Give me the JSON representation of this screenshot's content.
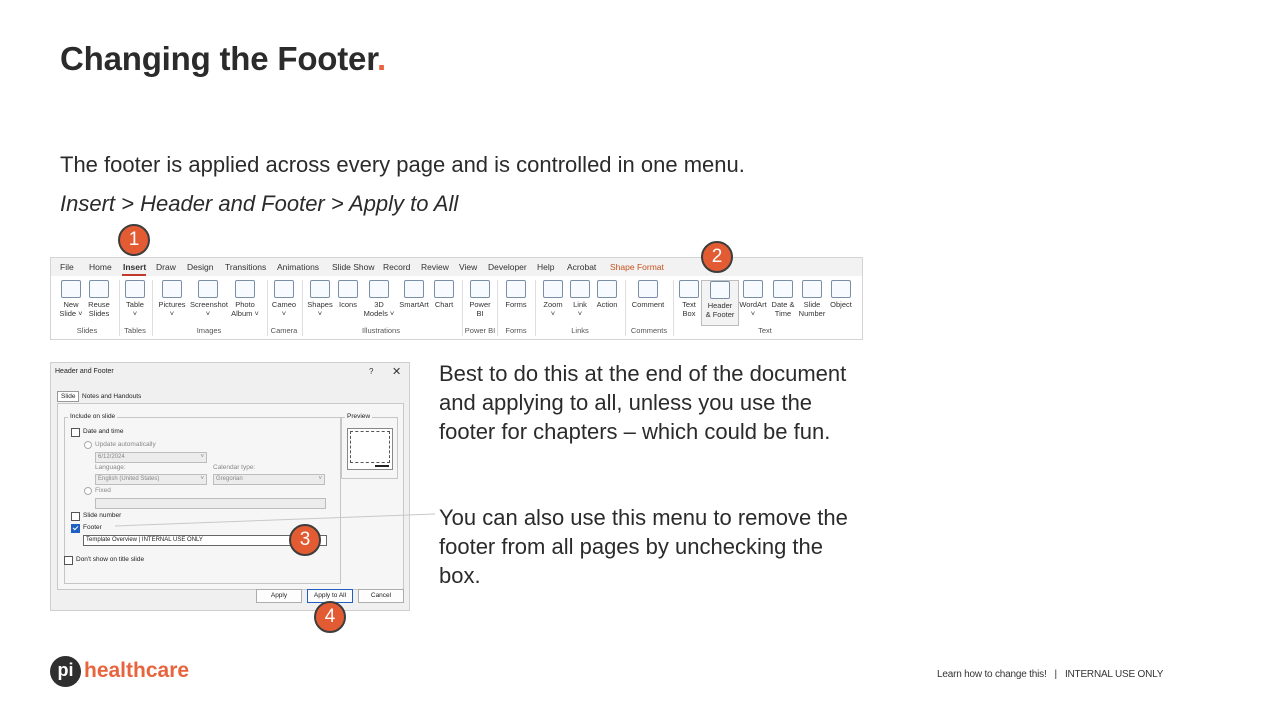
{
  "slide": {
    "title": "Changing the Footer",
    "title_punct": ".",
    "intro": "The footer is applied across every page and is controlled in one menu.",
    "path": "Insert > Header and Footer > Apply to All",
    "para1": "Best to do this at the end of the document and applying to all, unless you use the footer for chapters – which could be fun.",
    "para2": "You can also use this menu to remove the footer from all pages by unchecking the box."
  },
  "badges": [
    "1",
    "2",
    "3",
    "4"
  ],
  "ribbon": {
    "tabs": [
      "File",
      "Home",
      "Insert",
      "Draw",
      "Design",
      "Transitions",
      "Animations",
      "Slide Show",
      "Record",
      "Review",
      "View",
      "Developer",
      "Help",
      "Acrobat",
      "Shape Format"
    ],
    "buttons": [
      {
        "label": "New\nSlide ˅",
        "icon": "new-slide-icon"
      },
      {
        "label": "Reuse\nSlides",
        "icon": "reuse-slides-icon"
      },
      {
        "label": "Table\n˅",
        "icon": "table-icon"
      },
      {
        "label": "Pictures\n˅",
        "icon": "pictures-icon"
      },
      {
        "label": "Screenshot\n˅",
        "icon": "screenshot-icon"
      },
      {
        "label": "Photo\nAlbum ˅",
        "icon": "photo-album-icon"
      },
      {
        "label": "Cameo\n˅",
        "icon": "cameo-icon"
      },
      {
        "label": "Shapes\n˅",
        "icon": "shapes-icon"
      },
      {
        "label": "Icons",
        "icon": "icons-icon"
      },
      {
        "label": "3D\nModels ˅",
        "icon": "3d-models-icon"
      },
      {
        "label": "SmartArt",
        "icon": "smartart-icon"
      },
      {
        "label": "Chart",
        "icon": "chart-icon"
      },
      {
        "label": "Power\nBI",
        "icon": "power-bi-icon"
      },
      {
        "label": "Forms",
        "icon": "forms-icon"
      },
      {
        "label": "Zoom\n˅",
        "icon": "zoom-icon"
      },
      {
        "label": "Link\n˅",
        "icon": "link-icon"
      },
      {
        "label": "Action",
        "icon": "action-icon"
      },
      {
        "label": "Comment",
        "icon": "comment-icon"
      },
      {
        "label": "Text\nBox",
        "icon": "text-box-icon"
      },
      {
        "label": "Header\n& Footer",
        "icon": "header-footer-icon"
      },
      {
        "label": "WordArt\n˅",
        "icon": "wordart-icon"
      },
      {
        "label": "Date &\nTime",
        "icon": "date-time-icon"
      },
      {
        "label": "Slide\nNumber",
        "icon": "slide-number-icon"
      },
      {
        "label": "Object",
        "icon": "object-icon"
      }
    ],
    "groups": [
      "Slides",
      "Tables",
      "Images",
      "Camera",
      "Illustrations",
      "Power BI",
      "Forms",
      "Links",
      "Comments",
      "Text"
    ]
  },
  "dialog": {
    "title": "Header and Footer",
    "help": "?",
    "close": "✕",
    "tab_slide": "Slide",
    "tab_notes": "Notes and Handouts",
    "include_legend": "Include on slide",
    "preview_legend": "Preview",
    "date_time": "Date and time",
    "update_auto": "Update automatically",
    "date_value": "6/12/2024",
    "language_label": "Language:",
    "language_value": "English (United States)",
    "calendar_label": "Calendar type:",
    "calendar_value": "Gregorian",
    "fixed": "Fixed",
    "slide_number": "Slide number",
    "footer": "Footer",
    "footer_value": "Template Overview   |   INTERNAL USE ONLY",
    "dont_show": "Don't show on title slide",
    "apply": "Apply",
    "apply_all": "Apply to All",
    "cancel": "Cancel"
  },
  "footer": {
    "logo_mark": "pi",
    "logo_text": "healthcare",
    "note": "Learn how to change this!",
    "sep": "|",
    "classification": "INTERNAL USE ONLY"
  },
  "colors": {
    "accent": "#e8643c",
    "badge": "#e35b32",
    "check": "#1f5fbf"
  }
}
